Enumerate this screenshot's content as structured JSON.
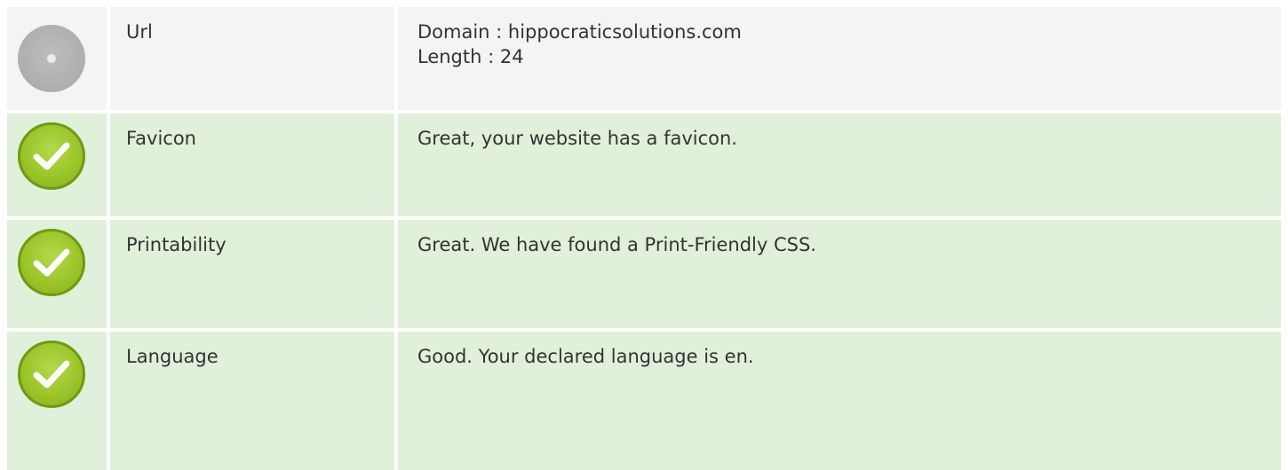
{
  "rows": [
    {
      "status": "neutral",
      "label": "Url",
      "lines": [
        "Domain : hippocraticsolutions.com",
        "Length : 24"
      ]
    },
    {
      "status": "ok",
      "label": "Favicon",
      "lines": [
        "Great, your website has a favicon."
      ]
    },
    {
      "status": "ok",
      "label": "Printability",
      "lines": [
        "Great. We have found a Print-Friendly CSS."
      ]
    },
    {
      "status": "ok",
      "label": "Language",
      "lines": [
        "Good. Your declared language is en."
      ]
    }
  ],
  "colors": {
    "neutral_bg": "#f4f4f4",
    "ok_bg": "#e0f0da",
    "ok_icon": "#9cc52a",
    "neutral_icon": "#b0b0b0"
  },
  "icons": {
    "neutral": "neutral-status-icon",
    "ok": "check-circle-icon"
  }
}
